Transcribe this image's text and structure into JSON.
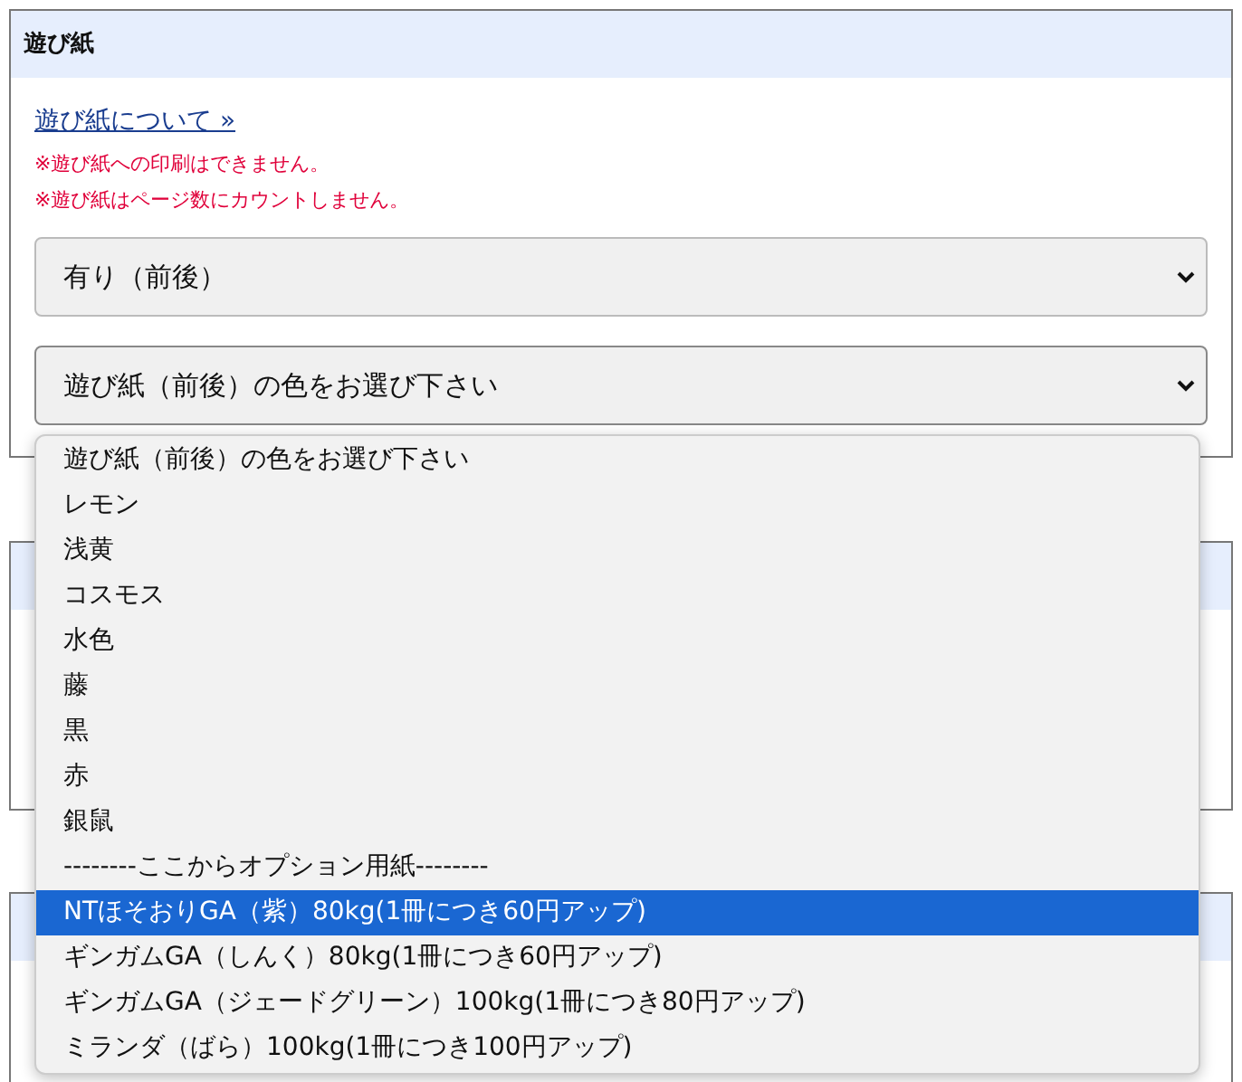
{
  "section": {
    "title": "遊び紙",
    "link": "遊び紙について »",
    "notes": [
      "※遊び紙への印刷はできません。",
      "※遊び紙はページ数にカウントしません。"
    ],
    "selects": [
      {
        "value": "有り（前後）",
        "expanded": false
      },
      {
        "value": "遊び紙（前後）の色をお選び下さい",
        "expanded": true
      }
    ]
  },
  "dropdown": {
    "options": [
      {
        "label": "遊び紙（前後）の色をお選び下さい",
        "selected": false
      },
      {
        "label": "レモン",
        "selected": false
      },
      {
        "label": "浅黄",
        "selected": false
      },
      {
        "label": "コスモス",
        "selected": false
      },
      {
        "label": "水色",
        "selected": false
      },
      {
        "label": "藤",
        "selected": false
      },
      {
        "label": "黒",
        "selected": false
      },
      {
        "label": "赤",
        "selected": false
      },
      {
        "label": "銀鼠",
        "selected": false
      },
      {
        "label": "--------ここからオプション用紙--------",
        "selected": false
      },
      {
        "label": "NTほそおりGA（紫）80kg(1冊につき60円アップ)",
        "selected": true
      },
      {
        "label": "ギンガムGA（しんく）80kg(1冊につき60円アップ)",
        "selected": false
      },
      {
        "label": "ギンガムGA（ジェードグリーン）100kg(1冊につき80円アップ)",
        "selected": false
      },
      {
        "label": "ミランダ（ばら）100kg(1冊につき100円アップ)",
        "selected": false
      }
    ]
  }
}
